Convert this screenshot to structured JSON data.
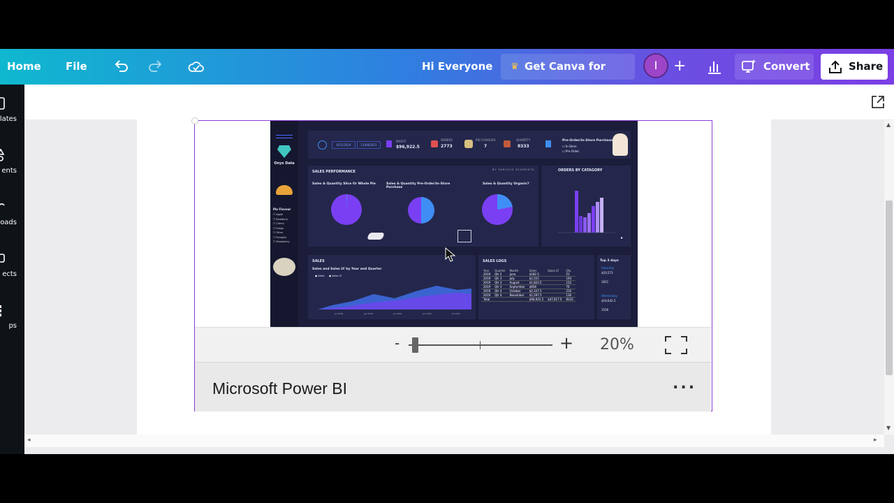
{
  "topbar": {
    "home_label": "Home",
    "file_label": "File",
    "greeting": "Hi Everyone",
    "teams_label": "Get Canva for Teams",
    "avatar_initial": "I",
    "convert_label": "Convert",
    "share_label": "Share",
    "colors": {
      "gradient_start": "#0fb8cf",
      "gradient_end": "#7b3fe4",
      "avatar": "#9d45c7"
    }
  },
  "sidebar": {
    "items": [
      {
        "label": "lates",
        "icon": "templates-icon"
      },
      {
        "label": "ents",
        "icon": "elements-icon"
      },
      {
        "label": "oads",
        "icon": "uploads-icon"
      },
      {
        "label": "ects",
        "icon": "projects-icon"
      },
      {
        "label": "ps",
        "icon": "apps-icon"
      }
    ]
  },
  "embed": {
    "title": "Microsoft Power BI",
    "zoom_minus": "-",
    "zoom_plus": "+",
    "zoom_level_text": "20%",
    "zoom_level": 0.2,
    "more_label": "...",
    "dashboard": {
      "brand": "Onyx Data",
      "date_from": "6/11/2019",
      "date_to": "11/08/2021",
      "kpis": [
        {
          "label": "PROFIT",
          "value": "$96,922.5"
        },
        {
          "label": "ORDERS",
          "value": "2773"
        },
        {
          "label": "PIE FLAVOURS",
          "value": "7"
        },
        {
          "label": "QUANTITY",
          "value": "8333"
        }
      ],
      "slicer_title": "Pre-Order/In-Store Purchase",
      "slicer_options": [
        "In-Store",
        "Pre-Order"
      ],
      "pie_flavour_title": "Pie Flavour",
      "pie_flavours": [
        "Apple",
        "Blueberry",
        "Cherry",
        "Fudge",
        "Other",
        "Pumpkin",
        "Strawberry"
      ],
      "sales_perf_title": "SALES PERFORMANCE",
      "segments_label": "BY VARIOUS SEGMENTS",
      "pie_titles": [
        "Sales & Quantity Slice Or Whole Pie",
        "Sales & Quantity Pre-Order/In-Store Purchase",
        "Sales & Quantity Organic?"
      ],
      "orders_cat_title": "ORDERS BY CATAGORY",
      "sales_title": "SALES",
      "sales_subtitle": "Sales and Sales LY by Year and Quarter",
      "sales_legend": [
        "Sales",
        "Sales LY"
      ],
      "sales_x": [
        "Jul 2019",
        "Jan 2020",
        "Jul 2020",
        "Jan 2021",
        "Jul 2021"
      ],
      "sales_logs_title": "SALES LOGS",
      "sales_logs_headers": [
        "Year",
        "Quarter",
        "Month",
        "Sales",
        "Sales LY",
        "Qty"
      ],
      "sales_logs_rows": [
        [
          "2019",
          "Qtr 2",
          "June",
          "$182.5",
          "",
          "51"
        ],
        [
          "2019",
          "Qtr 3",
          "July",
          "$2,515",
          "",
          "193"
        ],
        [
          "2019",
          "Qtr 3",
          "August",
          "$1,822.5",
          "",
          "152"
        ],
        [
          "2019",
          "Qtr 3",
          "September",
          "$858",
          "",
          "76"
        ],
        [
          "2019",
          "Qtr 4",
          "October",
          "$2,337.5",
          "",
          "210"
        ],
        [
          "2019",
          "Qtr 4",
          "November",
          "$1,597.5",
          "",
          "136"
        ],
        [
          "Total",
          "",
          "",
          "$96,922.5",
          "$47,617.5",
          "8333"
        ]
      ],
      "top_days_title": "Top 3 days",
      "top_days": [
        {
          "day": "Saturday",
          "sales": "$20,573",
          "qty": "1811"
        },
        {
          "day": "Wednesday",
          "sales": "$18,642.5",
          "qty": "1556"
        }
      ]
    }
  },
  "colors": {
    "dashboard_bg": "#1b1d3a",
    "pie_purple": "#7a3ff2",
    "pie_blue": "#3f8ef5",
    "selection": "#8b3fd8"
  }
}
